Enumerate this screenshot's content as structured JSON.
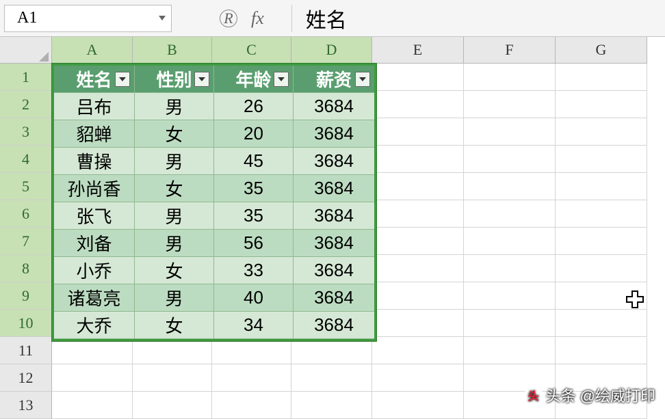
{
  "formula_bar": {
    "cell_ref": "A1",
    "fx_label": "fx",
    "content": "姓名"
  },
  "columns": {
    "labels": [
      "A",
      "B",
      "C",
      "D",
      "E",
      "F",
      "G"
    ],
    "classes": [
      "wA",
      "wB",
      "wC",
      "wD",
      "wE",
      "wF",
      "wG"
    ],
    "selected": [
      true,
      true,
      true,
      true,
      false,
      false,
      false
    ]
  },
  "rows": {
    "count": 13,
    "selected_through": 10
  },
  "table": {
    "headers": [
      "姓名",
      "性别",
      "年龄",
      "薪资"
    ],
    "data": [
      [
        "吕布",
        "男",
        "26",
        "3684"
      ],
      [
        "貂蝉",
        "女",
        "20",
        "3684"
      ],
      [
        "曹操",
        "男",
        "45",
        "3684"
      ],
      [
        "孙尚香",
        "女",
        "35",
        "3684"
      ],
      [
        "张飞",
        "男",
        "35",
        "3684"
      ],
      [
        "刘备",
        "男",
        "56",
        "3684"
      ],
      [
        "小乔",
        "女",
        "33",
        "3684"
      ],
      [
        "诸葛亮",
        "男",
        "40",
        "3684"
      ],
      [
        "大乔",
        "女",
        "34",
        "3684"
      ]
    ]
  },
  "watermark": {
    "text": "@绘威打印",
    "prefix": "头条"
  }
}
